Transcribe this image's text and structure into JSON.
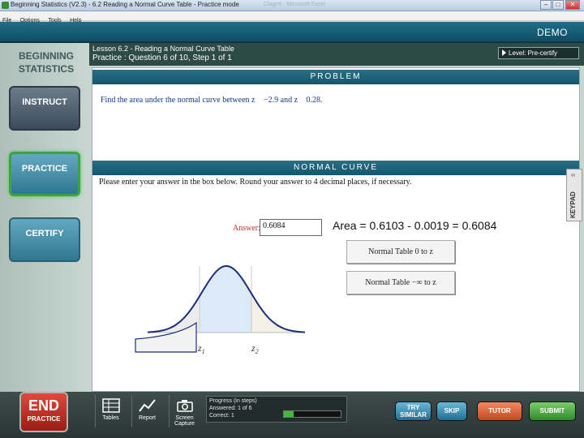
{
  "window": {
    "title": "Beginning Statistics (V2.3) - 6.2 Reading a Normal Curve Table - Practice mode",
    "faint_title": "Clagett - Microsoft Excel"
  },
  "menu": [
    "File",
    "Options",
    "Tools",
    "Help"
  ],
  "mode_label": "DEMO",
  "sidebar": {
    "brand_line1": "BEGINNING",
    "brand_line2": "STATISTICS",
    "instruct_label": "INSTRUCT",
    "practice_label": "PRACTICE",
    "certify_label": "CERTIFY"
  },
  "lesson": {
    "title": "Lesson 6.2 - Reading a Normal Curve Table",
    "progress_line": "Practice : Question 6 of 10, Step 1 of 1",
    "level_label": "Level:",
    "level_value": "Pre-certify"
  },
  "problem": {
    "header": "PROBLEM",
    "text_prefix": "Find the area under the normal curve between z",
    "z1": "−2.9",
    "text_mid": "and z",
    "z2": "0.28."
  },
  "normal_curve": {
    "header": "NORMAL CURVE",
    "instructions": "Please enter your answer in the box below.  Round your answer to 4 decimal places, if necessary.",
    "answer_label": "Answer:",
    "answer_value": "0.6084",
    "annotation": "Area = 0.6103 -  0.0019 = 0.6084",
    "table_button_1": "Normal Table  0 to z",
    "table_button_2": "Normal Table  −∞ to z",
    "z1_label": "z",
    "z1_sub": "1",
    "z2_label": "z",
    "z2_sub": "2",
    "shade_color": "#dce9f7",
    "curve_color": "#1a2f7a"
  },
  "keypad_label": "KEYPAD",
  "bottom": {
    "end_label": "END",
    "end_sub": "PRACTICE",
    "tools": {
      "tables": "Tables",
      "report": "Report",
      "screen_line1": "Screen",
      "screen_line2": "Capture"
    },
    "progress": {
      "title": "Progress (in steps)",
      "answered_label": "Answered:",
      "answered_value": "1 of 6",
      "correct_label": "Correct:",
      "correct_value": "1",
      "fraction": 0.17
    },
    "buttons": {
      "try_line1": "TRY",
      "try_line2": "SIMILAR",
      "skip": "SKIP",
      "tutor": "TUTOR",
      "submit": "SUBMIT"
    }
  }
}
